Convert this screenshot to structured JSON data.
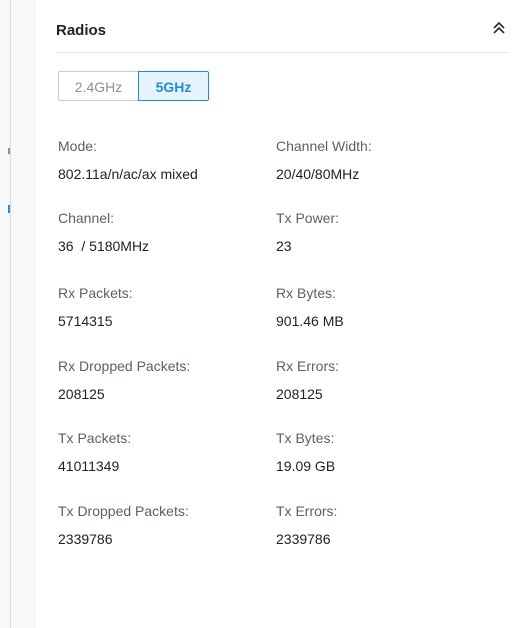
{
  "panel": {
    "title": "Radios"
  },
  "band_tabs": [
    {
      "label": "2.4GHz",
      "selected": false
    },
    {
      "label": "5GHz",
      "selected": true
    }
  ],
  "stats": {
    "mode": {
      "label": "Mode:",
      "value": "802.11a/n/ac/ax mixed"
    },
    "channel_width": {
      "label": "Channel Width:",
      "value": "20/40/80MHz"
    },
    "channel": {
      "label": "Channel:",
      "value": "36  / 5180MHz"
    },
    "tx_power": {
      "label": "Tx Power:",
      "value": "23"
    },
    "rx_packets": {
      "label": "Rx Packets:",
      "value": "5714315"
    },
    "rx_bytes": {
      "label": "Rx Bytes:",
      "value": "901.46 MB"
    },
    "rx_dropped_packets": {
      "label": "Rx Dropped Packets:",
      "value": "208125"
    },
    "rx_errors": {
      "label": "Rx Errors:",
      "value": "208125"
    },
    "tx_packets": {
      "label": "Tx Packets:",
      "value": "41011349"
    },
    "tx_bytes": {
      "label": "Tx Bytes:",
      "value": "19.09 GB"
    },
    "tx_dropped_packets": {
      "label": "Tx Dropped Packets:",
      "value": "2339786"
    },
    "tx_errors": {
      "label": "Tx Errors:",
      "value": "2339786"
    }
  },
  "icons": {
    "collapse": "chevron-double-up-icon"
  },
  "colors": {
    "accent": "#1f8ed6",
    "accent_bg": "#e6f3fc",
    "label": "#5b6068",
    "value": "#222222"
  }
}
